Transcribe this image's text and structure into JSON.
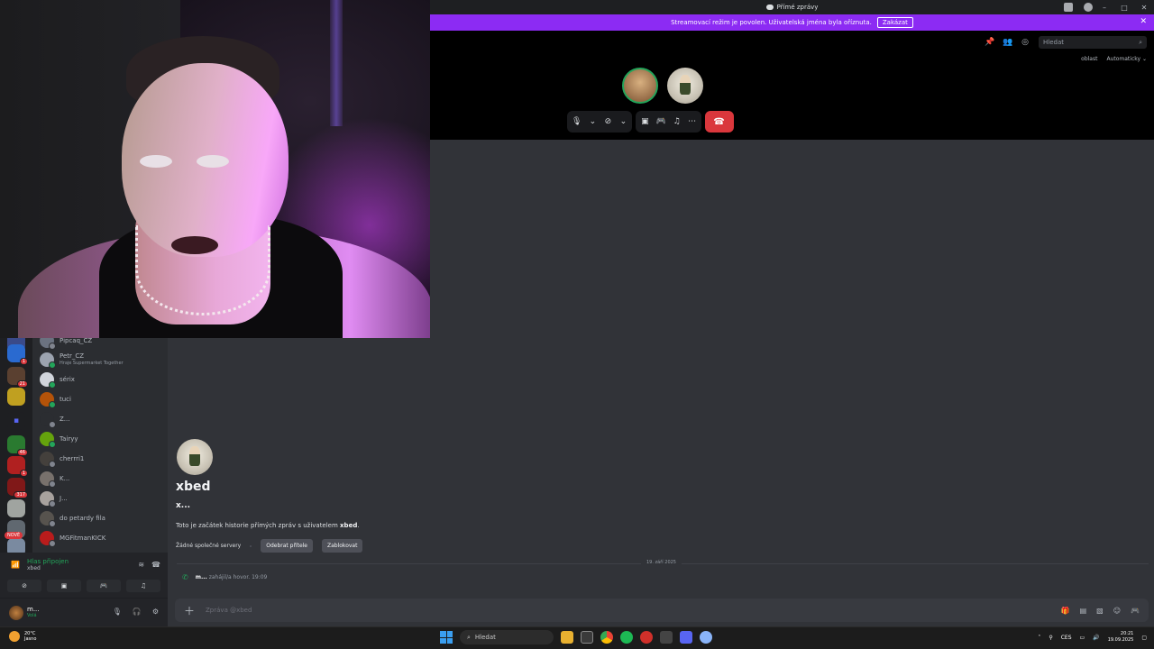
{
  "window": {
    "title": "Přímé zprávy"
  },
  "banner": {
    "message": "Streamovací režim je povolen. Uživatelská jména byla oříznuta.",
    "disable_label": "Zakázat",
    "close_symbol": "✕"
  },
  "call": {
    "search_placeholder": "Hledat",
    "region_label": "oblast",
    "region_value": "Automaticky",
    "tool_icons": [
      "pin-icon",
      "add-friend-icon",
      "inbox-icon"
    ],
    "participants": [
      {
        "name": "participant-1",
        "speaking": true
      },
      {
        "name": "participant-2",
        "speaking": false
      }
    ],
    "controls": [
      "microphone-icon",
      "camera-off-icon",
      "screen-share-icon",
      "activity-icon",
      "soundboard-icon",
      "more-icon",
      "hang-up-icon"
    ]
  },
  "rail": {
    "badges": [
      "1",
      "21",
      "46",
      "1",
      "317"
    ],
    "new_badge": "NOVÉ"
  },
  "dm_list": [
    {
      "name": "Pipcaq_CZ",
      "activity": "",
      "online": false,
      "color": "#6b7280"
    },
    {
      "name": "Petr_CZ",
      "activity": "Hraje Supermarket Together",
      "online": true,
      "color": "#9ca3af"
    },
    {
      "name": "sérix",
      "activity": "",
      "online": true,
      "color": "#d1d5db"
    },
    {
      "name": "tuci",
      "activity": "",
      "online": true,
      "color": "#b45309"
    },
    {
      "name": "Z...",
      "activity": "",
      "online": false,
      "color": "#2b2d31"
    },
    {
      "name": "Tairyy",
      "activity": "",
      "online": true,
      "color": "#65a30d"
    },
    {
      "name": "cherrri1",
      "activity": "",
      "online": false,
      "color": "#44403c"
    },
    {
      "name": "K...",
      "activity": "",
      "online": false,
      "color": "#78716c"
    },
    {
      "name": "J...",
      "activity": "",
      "online": false,
      "color": "#a8a29e"
    },
    {
      "name": "do petardy fila",
      "activity": "",
      "online": false,
      "color": "#57534e"
    },
    {
      "name": "MGFitmanKICK",
      "activity": "",
      "online": false,
      "color": "#b91c1c"
    }
  ],
  "voice": {
    "status": "Hlas připojen",
    "channel": "xbed"
  },
  "user": {
    "name": "m...",
    "status": "Volá"
  },
  "chat": {
    "display_name": "xbed",
    "username": "x...",
    "intro_prefix": "Toto je začátek historie přímých zpráv s uživatelem ",
    "intro_name": "xbed",
    "intro_suffix": ".",
    "no_servers": "Žádné společné servery",
    "remove_friend": "Odebrat přítele",
    "block": "Zablokovat",
    "date_divider": "19. září 2025",
    "call_user": "m...",
    "call_text": "zahájil/a hovor.",
    "call_time": "19:09",
    "composer_placeholder": "Zpráva @xbed"
  },
  "taskbar": {
    "temperature": "20°C",
    "weather": "Jasno",
    "search_label": "Hledat",
    "language": "CES",
    "time": "20:21",
    "date": "19.09.2025"
  }
}
